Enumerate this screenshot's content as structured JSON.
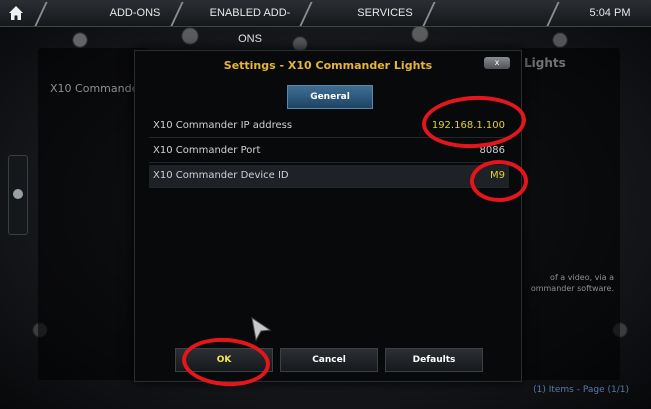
{
  "topbar": {
    "crumbs": [
      "ADD-ONS",
      "ENABLED ADD-ONS",
      "SERVICES"
    ],
    "time": "5:04 PM"
  },
  "background": {
    "left_text": "X10 Commander",
    "right_title": "Lights",
    "right_desc": "of a video, via a ommander software.",
    "footer_count": "(1)",
    "footer_items": " Items - Page (",
    "footer_page": "1/1",
    "footer_close": ")"
  },
  "dialog": {
    "title": "Settings - X10 Commander Lights",
    "close_label": "x",
    "tab": "General",
    "rows": [
      {
        "label": "X10 Commander IP address",
        "value": "192.168.1.100"
      },
      {
        "label": "X10 Commander Port",
        "value": "8086"
      },
      {
        "label": "X10 Commander Device ID",
        "value": "M9"
      }
    ],
    "buttons": {
      "ok": "OK",
      "cancel": "Cancel",
      "defaults": "Defaults"
    }
  },
  "colors": {
    "title": "#e6b53a",
    "value_highlight": "#e0d034",
    "annotation": "#e4161b",
    "tab": "#2a5a80"
  }
}
